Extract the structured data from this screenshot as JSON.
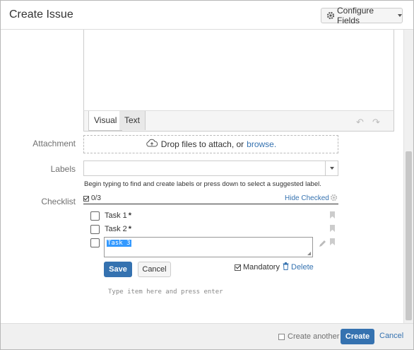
{
  "dialog": {
    "title": "Create Issue",
    "configure_fields_label": "Configure Fields"
  },
  "editor": {
    "tabs": [
      {
        "label": "Visual",
        "active": true
      },
      {
        "label": "Text",
        "active": false
      }
    ],
    "undo_icon": "undo-icon",
    "redo_icon": "redo-icon"
  },
  "attachment": {
    "label": "Attachment",
    "drop_text": "Drop files to attach, or",
    "browse_link": "browse."
  },
  "labels": {
    "label": "Labels",
    "value": "",
    "hint": "Begin typing to find and create labels or press down to select a suggested label."
  },
  "checklist": {
    "label": "Checklist",
    "count": "0/3",
    "hide_checked": "Hide Checked",
    "items": [
      {
        "label": "Task 1",
        "mandatory_marker": "*",
        "checked": false
      },
      {
        "label": "Task 2",
        "mandatory_marker": "*",
        "checked": false
      }
    ],
    "editing_item_text": "Task 3",
    "save_label": "Save",
    "cancel_label": "Cancel",
    "mandatory_label": "Mandatory",
    "mandatory_checked": true,
    "delete_label": "Delete",
    "new_item_placeholder": "Type item here and press enter"
  },
  "footer": {
    "create_another_label": "Create another",
    "create_label": "Create",
    "cancel_label": "Cancel"
  },
  "colors": {
    "primary": "#3572b0",
    "link": "#3572b0",
    "selection": "#3399ff"
  }
}
